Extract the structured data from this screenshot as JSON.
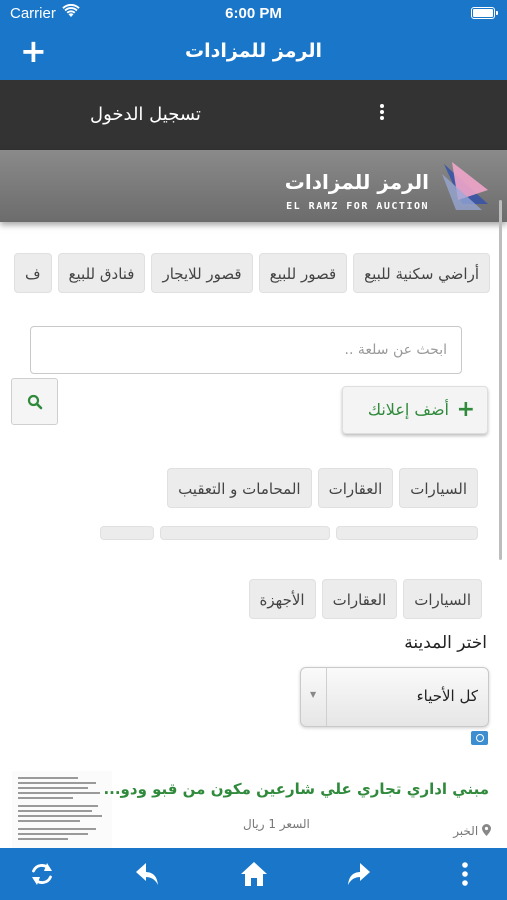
{
  "status_bar": {
    "carrier": "Carrier",
    "time": "6:00 PM"
  },
  "nav": {
    "title": "الرمز للمزادات",
    "add_label": "+"
  },
  "menu": {
    "login": "تسجيل الدخول"
  },
  "logo": {
    "arabic": "الرمز للمزادات",
    "english": "EL RAMZ FOR AUCTION"
  },
  "category_row_1": [
    "أراضي سكنية للبيع",
    "قصور للبيع",
    "قصور للايجار",
    "فنادق للبيع",
    "ف"
  ],
  "search": {
    "placeholder": "ابحث عن سلعة .."
  },
  "add_ad": {
    "label": "أضف إعلانك"
  },
  "category_row_2": [
    "السيارات",
    "العقارات",
    "المحامات و التعقيب"
  ],
  "category_row_4": [
    "السيارات",
    "العقارات",
    "الأجهزة"
  ],
  "city": {
    "label": "اختر المدينة",
    "selected": "كل الأحياء"
  },
  "listing": {
    "title": "مبني اداري تجاري علي شارعين مكون من قبو ودو...",
    "price": "السعر 1 ريال",
    "location": "الخبر"
  },
  "icons": {
    "wifi": "wifi-icon",
    "battery": "battery-icon",
    "kebab": "more-vertical-icon",
    "search": "search-icon",
    "camera": "camera-icon",
    "location": "location-pin-icon",
    "refresh": "refresh-icon",
    "back": "reply-icon",
    "home": "home-icon",
    "forward": "forward-icon",
    "more": "more-vertical-icon"
  },
  "colors": {
    "primary": "#1976c8",
    "menu": "#333333",
    "accent_green": "#2f8a3b"
  }
}
